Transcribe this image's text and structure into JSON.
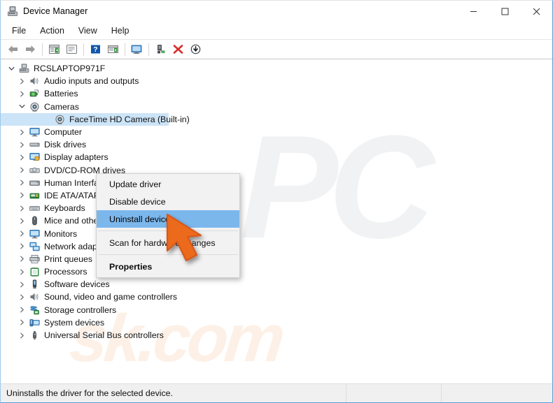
{
  "window": {
    "title": "Device Manager",
    "icon": "device-manager-icon",
    "controls": {
      "minimize": "minimize-icon",
      "maximize": "maximize-icon",
      "close": "close-icon"
    }
  },
  "menubar": {
    "items": [
      {
        "label": "File"
      },
      {
        "label": "Action"
      },
      {
        "label": "View"
      },
      {
        "label": "Help"
      }
    ]
  },
  "toolbar": {
    "buttons": [
      {
        "name": "back-icon",
        "tip": "Back"
      },
      {
        "name": "forward-icon",
        "tip": "Forward"
      },
      {
        "name": "show-hide-console-tree-icon",
        "tip": "Show/Hide Console Tree"
      },
      {
        "name": "properties-icon",
        "tip": "Properties"
      },
      {
        "name": "help-icon",
        "tip": "Help"
      },
      {
        "name": "update-driver-icon",
        "tip": "Update driver"
      },
      {
        "name": "scan-hardware-changes-icon",
        "tip": "Scan for hardware changes"
      },
      {
        "name": "enable-device-icon",
        "tip": "Enable device"
      },
      {
        "name": "uninstall-device-icon",
        "tip": "Uninstall device"
      },
      {
        "name": "disable-device-icon",
        "tip": "Disable device"
      }
    ]
  },
  "tree": {
    "root": {
      "label": "RCSLAPTOP971F",
      "icon": "computer-root-icon",
      "expanded": true
    },
    "nodes": [
      {
        "label": "Audio inputs and outputs",
        "icon": "speaker-icon",
        "depth": 1,
        "expanded": false,
        "selected": false
      },
      {
        "label": "Batteries",
        "icon": "battery-icon",
        "depth": 1,
        "expanded": false,
        "selected": false
      },
      {
        "label": "Cameras",
        "icon": "camera-icon",
        "depth": 1,
        "expanded": true,
        "selected": false
      },
      {
        "label": "FaceTime HD Camera (Built-in)",
        "icon": "camera-icon",
        "depth": 2,
        "expanded": null,
        "selected": true
      },
      {
        "label": "Computer",
        "icon": "monitor-icon",
        "depth": 1,
        "expanded": false,
        "selected": false
      },
      {
        "label": "Disk drives",
        "icon": "disk-drive-icon",
        "depth": 1,
        "expanded": false,
        "selected": false
      },
      {
        "label": "Display adapters",
        "icon": "display-adapter-icon",
        "depth": 1,
        "expanded": false,
        "selected": false
      },
      {
        "label": "DVD/CD-ROM drives",
        "icon": "dvd-drive-icon",
        "depth": 1,
        "expanded": false,
        "selected": false
      },
      {
        "label": "Human Interface Devices",
        "icon": "hid-icon",
        "depth": 1,
        "expanded": false,
        "selected": false
      },
      {
        "label": "IDE ATA/ATAPI controllers",
        "icon": "ide-controller-icon",
        "depth": 1,
        "expanded": false,
        "selected": false
      },
      {
        "label": "Keyboards",
        "icon": "keyboard-icon",
        "depth": 1,
        "expanded": false,
        "selected": false
      },
      {
        "label": "Mice and other pointing devices",
        "icon": "mouse-icon",
        "depth": 1,
        "expanded": false,
        "selected": false
      },
      {
        "label": "Monitors",
        "icon": "monitor-icon",
        "depth": 1,
        "expanded": false,
        "selected": false
      },
      {
        "label": "Network adapters",
        "icon": "network-adapter-icon",
        "depth": 1,
        "expanded": false,
        "selected": false
      },
      {
        "label": "Print queues",
        "icon": "printer-icon",
        "depth": 1,
        "expanded": false,
        "selected": false
      },
      {
        "label": "Processors",
        "icon": "processor-icon",
        "depth": 1,
        "expanded": false,
        "selected": false
      },
      {
        "label": "Software devices",
        "icon": "software-device-icon",
        "depth": 1,
        "expanded": false,
        "selected": false
      },
      {
        "label": "Sound, video and game controllers",
        "icon": "speaker-icon",
        "depth": 1,
        "expanded": false,
        "selected": false
      },
      {
        "label": "Storage controllers",
        "icon": "storage-controller-icon",
        "depth": 1,
        "expanded": false,
        "selected": false
      },
      {
        "label": "System devices",
        "icon": "system-device-icon",
        "depth": 1,
        "expanded": false,
        "selected": false
      },
      {
        "label": "Universal Serial Bus controllers",
        "icon": "usb-icon",
        "depth": 1,
        "expanded": false,
        "selected": false
      }
    ]
  },
  "context_menu": {
    "items": [
      {
        "label": "Update driver",
        "type": "item",
        "highlighted": false,
        "bold": false
      },
      {
        "label": "Disable device",
        "type": "item",
        "highlighted": false,
        "bold": false
      },
      {
        "label": "Uninstall device",
        "type": "item",
        "highlighted": true,
        "bold": false
      },
      {
        "type": "separator"
      },
      {
        "label": "Scan for hardware changes",
        "type": "item",
        "highlighted": false,
        "bold": false
      },
      {
        "type": "separator"
      },
      {
        "label": "Properties",
        "type": "item",
        "highlighted": false,
        "bold": true
      }
    ]
  },
  "statusbar": {
    "panel1": "Uninstalls the driver for the selected device.",
    "panel2": "",
    "panel3": ""
  },
  "watermark": {
    "big": "PC",
    "small": "sk.com"
  },
  "colors": {
    "selection": "#cce4f7",
    "menu_highlight": "#7cb7ec",
    "cursor": "#ec6b1f",
    "window_border": "#5a9fd4",
    "statusbar_bg": "#f0f0f0"
  }
}
